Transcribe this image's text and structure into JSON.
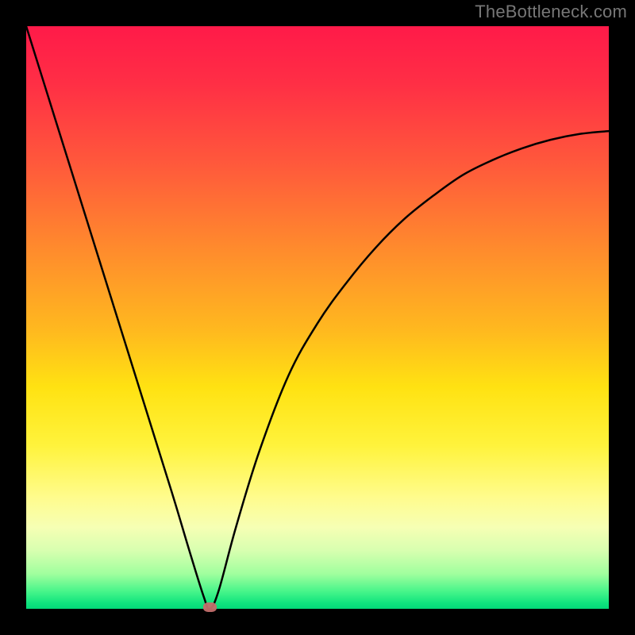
{
  "watermark": "TheBottleneck.com",
  "chart_data": {
    "type": "line",
    "title": "",
    "xlabel": "",
    "ylabel": "",
    "xlim": [
      0,
      100
    ],
    "ylim": [
      0,
      100
    ],
    "grid": false,
    "series": [
      {
        "name": "bottleneck-curve",
        "x": [
          0,
          5,
          10,
          15,
          20,
          25,
          28,
          30.5,
          31.5,
          33,
          36,
          40,
          45,
          50,
          55,
          60,
          65,
          70,
          75,
          80,
          85,
          90,
          95,
          100
        ],
        "values": [
          100,
          84,
          68,
          52,
          36,
          20,
          10,
          2,
          0,
          3,
          14,
          27,
          40,
          49,
          56,
          62,
          67,
          71,
          74.5,
          77,
          79,
          80.5,
          81.5,
          82
        ]
      }
    ],
    "marker": {
      "x": 31.5,
      "y": 0,
      "color": "#c36e6c"
    },
    "gradient_stops": [
      {
        "pos": 0,
        "color": "#ff1a49"
      },
      {
        "pos": 10,
        "color": "#ff2f45"
      },
      {
        "pos": 24,
        "color": "#ff5a3b"
      },
      {
        "pos": 38,
        "color": "#ff8a2d"
      },
      {
        "pos": 52,
        "color": "#ffb81f"
      },
      {
        "pos": 62,
        "color": "#ffe212"
      },
      {
        "pos": 72,
        "color": "#fff33c"
      },
      {
        "pos": 81,
        "color": "#fffc8e"
      },
      {
        "pos": 86,
        "color": "#f6ffb4"
      },
      {
        "pos": 90,
        "color": "#d8ffb0"
      },
      {
        "pos": 94,
        "color": "#a0ff9e"
      },
      {
        "pos": 97,
        "color": "#48f58a"
      },
      {
        "pos": 99,
        "color": "#10e47e"
      },
      {
        "pos": 100,
        "color": "#03d878"
      }
    ]
  }
}
